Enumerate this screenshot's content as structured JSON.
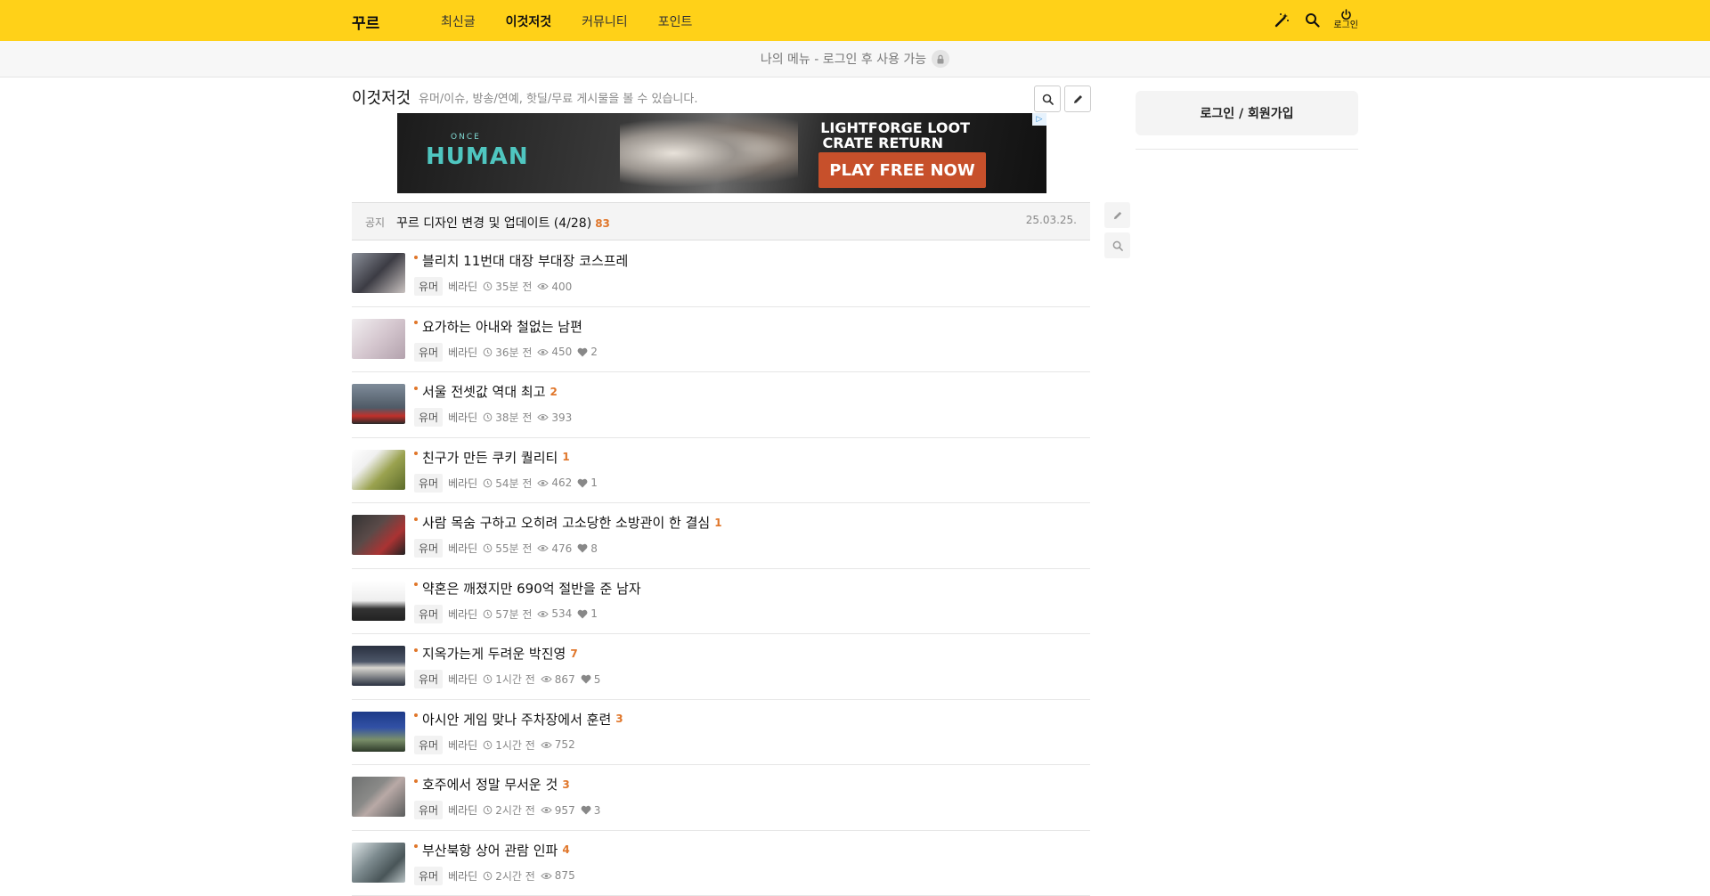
{
  "header": {
    "brand": "꾸르",
    "nav": [
      "최신글",
      "이것저것",
      "커뮤니티",
      "포인트"
    ],
    "active_nav": "이것저것",
    "icons": [
      "magic-wand-icon",
      "search-icon",
      "power-icon"
    ],
    "login_label": "로그인"
  },
  "mymenu": {
    "text": "나의 메뉴 - 로그인 후 사용 가능",
    "icon": "lock-icon"
  },
  "board": {
    "title": "이것저것",
    "description": "유머/이슈, 방송/연예, 핫딜/무료 게시물을 볼 수 있습니다."
  },
  "ad": {
    "brand_small": "ONCE",
    "brand_big": "HUMAN",
    "line1": "LIGHTFORGE LOOT",
    "line2": "CRATE RETURN",
    "cta": "PLAY FREE NOW",
    "badge": "▷"
  },
  "notice": {
    "tag": "공지",
    "title": "꾸르 디자인 변경 및 업데이트 (4/28)",
    "count": "83",
    "date": "25.03.25."
  },
  "posts": [
    {
      "title": "블리치 11번대 대장 부대장 코스프레",
      "comments": "",
      "category": "유머",
      "author": "베라딘",
      "time": "35분 전",
      "views": "400",
      "likes": ""
    },
    {
      "title": "요가하는 아내와 철없는 남편",
      "comments": "",
      "category": "유머",
      "author": "베라딘",
      "time": "36분 전",
      "views": "450",
      "likes": "2"
    },
    {
      "title": "서울 전셋값 역대 최고",
      "comments": "2",
      "category": "유머",
      "author": "베라딘",
      "time": "38분 전",
      "views": "393",
      "likes": ""
    },
    {
      "title": "친구가 만든 쿠키 퀄리티",
      "comments": "1",
      "category": "유머",
      "author": "베라딘",
      "time": "54분 전",
      "views": "462",
      "likes": "1"
    },
    {
      "title": "사람 목숨 구하고 오히려 고소당한 소방관이 한 결심",
      "comments": "1",
      "category": "유머",
      "author": "베라딘",
      "time": "55분 전",
      "views": "476",
      "likes": "8"
    },
    {
      "title": "약혼은 깨졌지만 690억 절반을 준 남자",
      "comments": "",
      "category": "유머",
      "author": "베라딘",
      "time": "57분 전",
      "views": "534",
      "likes": "1"
    },
    {
      "title": "지옥가는게 두려운 박진영",
      "comments": "7",
      "category": "유머",
      "author": "베라딘",
      "time": "1시간 전",
      "views": "867",
      "likes": "5"
    },
    {
      "title": "아시안 게임 맞나 주차장에서 훈련",
      "comments": "3",
      "category": "유머",
      "author": "베라딘",
      "time": "1시간 전",
      "views": "752",
      "likes": ""
    },
    {
      "title": "호주에서 정말 무서운 것",
      "comments": "3",
      "category": "유머",
      "author": "베라딘",
      "time": "2시간 전",
      "views": "957",
      "likes": "3"
    },
    {
      "title": "부산북항 상어 관람 인파",
      "comments": "4",
      "category": "유머",
      "author": "베라딘",
      "time": "2시간 전",
      "views": "875",
      "likes": ""
    }
  ],
  "sidebar": {
    "login_button": "로그인 / 회원가입"
  },
  "colors": {
    "header_bg": "#ffd118",
    "accent_orange": "#e0762a",
    "ad_cta": "#c7502b"
  }
}
